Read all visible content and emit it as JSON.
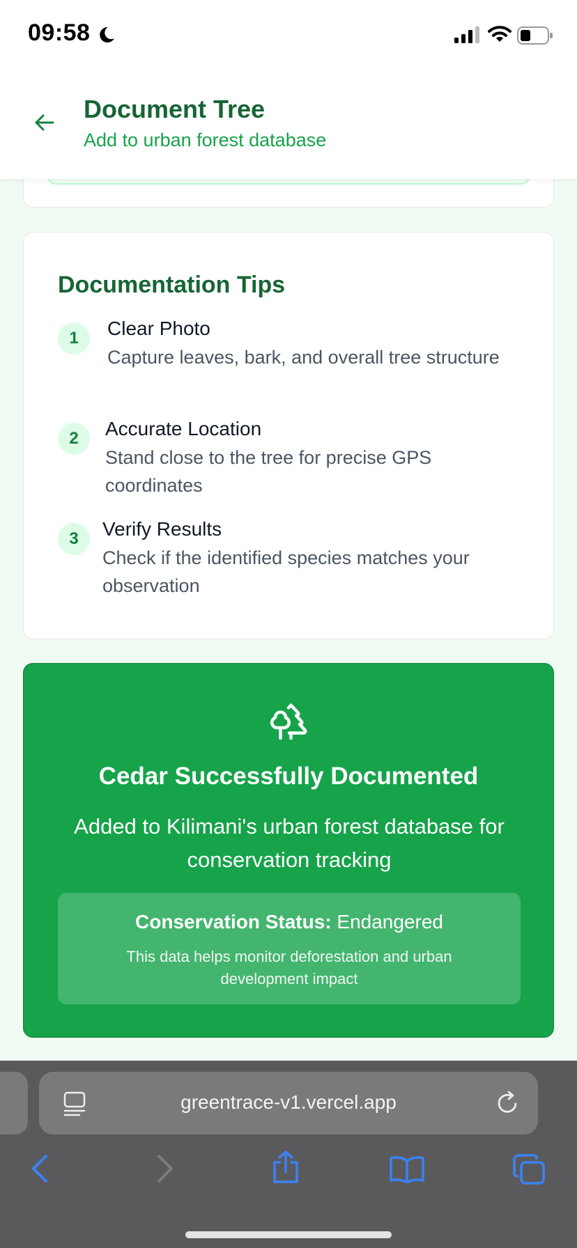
{
  "status_bar": {
    "time": "09:58"
  },
  "header": {
    "title": "Document Tree",
    "subtitle": "Add to urban forest database"
  },
  "tips": {
    "title": "Documentation Tips",
    "items": [
      {
        "number": "1",
        "title": "Clear Photo",
        "description": "Capture leaves, bark, and overall tree structure"
      },
      {
        "number": "2",
        "title": "Accurate Location",
        "description": "Stand close to the tree for precise GPS coordinates"
      },
      {
        "number": "3",
        "title": "Verify Results",
        "description": "Check if the identified species matches your observation"
      }
    ]
  },
  "success": {
    "icon": "trees-icon",
    "title": "Cedar Successfully Documented",
    "description": "Added to Kilimani's urban forest database for conservation tracking",
    "status_label": "Conservation Status:",
    "status_value": "Endangered",
    "note": "This data helps monitor deforestation and urban development impact"
  },
  "browser": {
    "url": "greentrace-v1.vercel.app"
  },
  "colors": {
    "brand_dark": "#166534",
    "brand": "#16a34a",
    "page_bg": "#f0fbf4",
    "browser_chrome": "#5a5a5c",
    "ios_blue": "#3b82f6"
  }
}
